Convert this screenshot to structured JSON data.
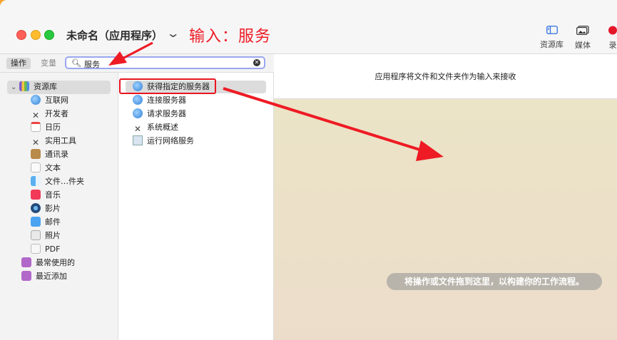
{
  "window": {
    "title": "未命名（应用程序）",
    "annotation": "输入：服务"
  },
  "toolbar": {
    "library_label": "资源库",
    "media_label": "媒体",
    "record_label": "录"
  },
  "sidebar_toggle": {
    "actions_label": "操作",
    "variables_label": "变量"
  },
  "search": {
    "value": "服务"
  },
  "library": {
    "root": "资源库",
    "items": [
      {
        "label": "互联网",
        "icon": "globe-icon"
      },
      {
        "label": "开发者",
        "icon": "tools-icon"
      },
      {
        "label": "日历",
        "icon": "calendar-icon"
      },
      {
        "label": "实用工具",
        "icon": "utilities-icon"
      },
      {
        "label": "通讯录",
        "icon": "contacts-icon"
      },
      {
        "label": "文本",
        "icon": "text-icon"
      },
      {
        "label": "文件…件夹",
        "icon": "finder-icon"
      },
      {
        "label": "音乐",
        "icon": "music-icon"
      },
      {
        "label": "影片",
        "icon": "movie-icon"
      },
      {
        "label": "邮件",
        "icon": "mail-icon"
      },
      {
        "label": "照片",
        "icon": "photos-icon"
      },
      {
        "label": "PDF",
        "icon": "pdf-icon"
      }
    ],
    "smart_groups": [
      {
        "label": "最常使用的",
        "icon": "smart-folder-icon"
      },
      {
        "label": "最近添加",
        "icon": "smart-folder-icon"
      }
    ]
  },
  "actions": [
    {
      "label": "获得指定的服务器",
      "icon": "globe-icon"
    },
    {
      "label": "连接服务器",
      "icon": "globe-icon"
    },
    {
      "label": "请求服务器",
      "icon": "globe-icon"
    },
    {
      "label": "系统概述",
      "icon": "tools-icon"
    },
    {
      "label": "运行网络服务",
      "icon": "network-icon"
    }
  ],
  "workflow": {
    "input_hint": "应用程序将文件和文件夹作为输入来接收",
    "drop_hint": "将操作或文件拖到这里，以构建你的工作流程。"
  },
  "colors": {
    "annotation": "#ee1b24",
    "search_border": "#9aa7ef",
    "canvas_bg": "#ebe4c6"
  }
}
